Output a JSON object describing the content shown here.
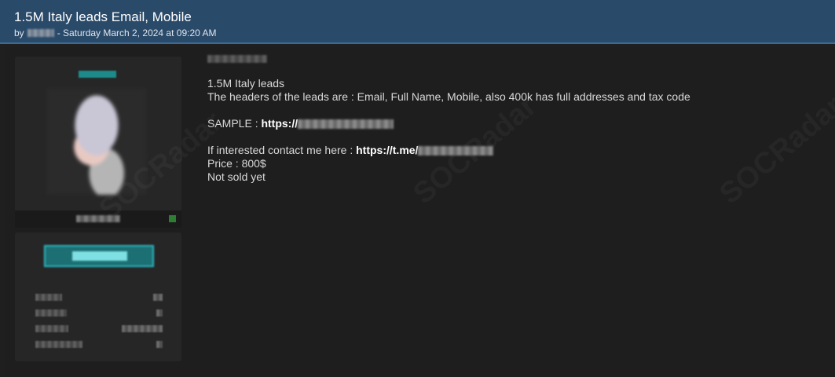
{
  "header": {
    "title": "1.5M Italy leads Email, Mobile",
    "by_prefix": "by",
    "date_text": "- Saturday March 2, 2024 at 09:20 AM"
  },
  "post": {
    "line1": "1.5M Italy leads",
    "line2": "The headers of the leads are : Email, Full Name, Mobile, also 400k has full addresses and tax code",
    "sample_prefix": "SAMPLE  : ",
    "sample_link": "https://",
    "contact_prefix": "If interested contact me here : ",
    "contact_link": "https://t.me/",
    "price": "Price : 800$",
    "status": "Not sold yet"
  },
  "watermark": {
    "text": "SOCRadar"
  },
  "colors": {
    "header_bg": "#2a4a6a",
    "page_bg": "#1f1f1f",
    "card_bg": "#262626",
    "accent_teal": "#1f8a8a"
  }
}
